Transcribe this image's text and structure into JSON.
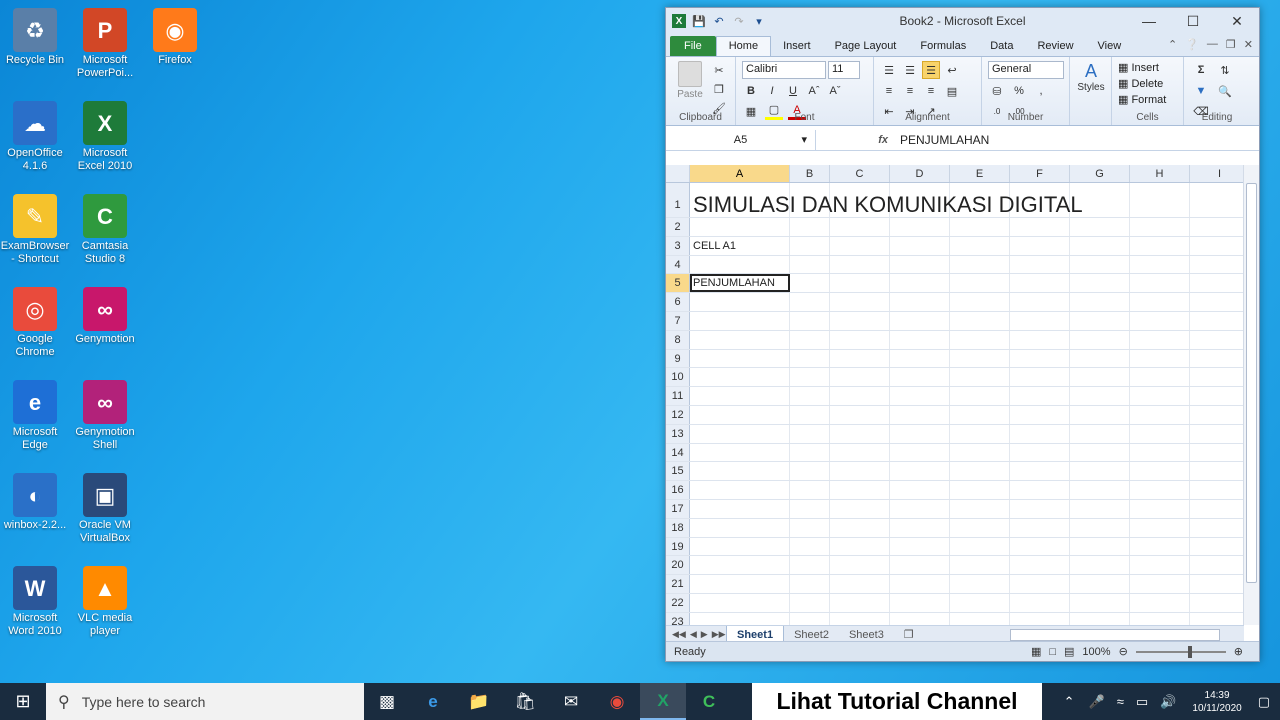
{
  "desktop": {
    "icons": [
      {
        "label": "Recycle Bin",
        "name": "recycle-bin-icon"
      },
      {
        "label": "Microsoft PowerPoi...",
        "name": "powerpoint-icon"
      },
      {
        "label": "Firefox",
        "name": "firefox-icon"
      },
      {
        "label": "OpenOffice 4.1.6",
        "name": "openoffice-icon"
      },
      {
        "label": "Microsoft Excel 2010",
        "name": "excel-icon"
      },
      {
        "label": "ExamBrowser - Shortcut",
        "name": "exambrowser-icon"
      },
      {
        "label": "Camtasia Studio 8",
        "name": "camtasia-icon"
      },
      {
        "label": "Google Chrome",
        "name": "chrome-icon"
      },
      {
        "label": "Genymotion",
        "name": "genymotion-icon"
      },
      {
        "label": "Microsoft Edge",
        "name": "edge-icon"
      },
      {
        "label": "Genymotion Shell",
        "name": "genymotion-shell-icon"
      },
      {
        "label": "winbox-2.2...",
        "name": "winbox-icon"
      },
      {
        "label": "Oracle VM VirtualBox",
        "name": "virtualbox-icon"
      },
      {
        "label": "Microsoft Word 2010",
        "name": "word-icon"
      },
      {
        "label": "VLC media player",
        "name": "vlc-icon"
      }
    ]
  },
  "excel": {
    "title": "Book2 - Microsoft Excel",
    "tabs": [
      "File",
      "Home",
      "Insert",
      "Page Layout",
      "Formulas",
      "Data",
      "Review",
      "View"
    ],
    "ribbon": {
      "clipboard": {
        "paste": "Paste",
        "name": "Clipboard"
      },
      "font": {
        "family": "Calibri",
        "size": "11",
        "bold": "B",
        "italic": "I",
        "underline": "U",
        "name": "Font"
      },
      "alignment": {
        "name": "Alignment"
      },
      "number": {
        "format": "General",
        "percent": "%",
        "comma": ",",
        "name": "Number"
      },
      "styles": {
        "label": "Styles"
      },
      "cells": {
        "insert": "Insert",
        "delete": "Delete",
        "format": "Format",
        "name": "Cells"
      },
      "editing": {
        "sigma": "Σ",
        "name": "Editing"
      }
    },
    "name_box": "A5",
    "fx": "fx",
    "formula_value": "PENJUMLAHAN",
    "columns": [
      "A",
      "B",
      "C",
      "D",
      "E",
      "F",
      "G",
      "H",
      "I"
    ],
    "rows": [
      "1",
      "2",
      "3",
      "4",
      "5",
      "6",
      "7",
      "8",
      "9",
      "10",
      "11",
      "12",
      "13",
      "14",
      "15",
      "16",
      "17",
      "18",
      "19",
      "20",
      "21",
      "22",
      "23"
    ],
    "cells": {
      "A1": "SIMULASI DAN KOMUNIKASI DIGITAL",
      "A3": "CELL A1",
      "A5": "PENJUMLAHAN"
    },
    "sheets": [
      "Sheet1",
      "Sheet2",
      "Sheet3"
    ],
    "status": "Ready",
    "zoom": "100%"
  },
  "taskbar": {
    "search_placeholder": "Type here to search",
    "overlay": "Lihat Tutorial Channel",
    "time": "14:39",
    "date": "10/11/2020"
  }
}
